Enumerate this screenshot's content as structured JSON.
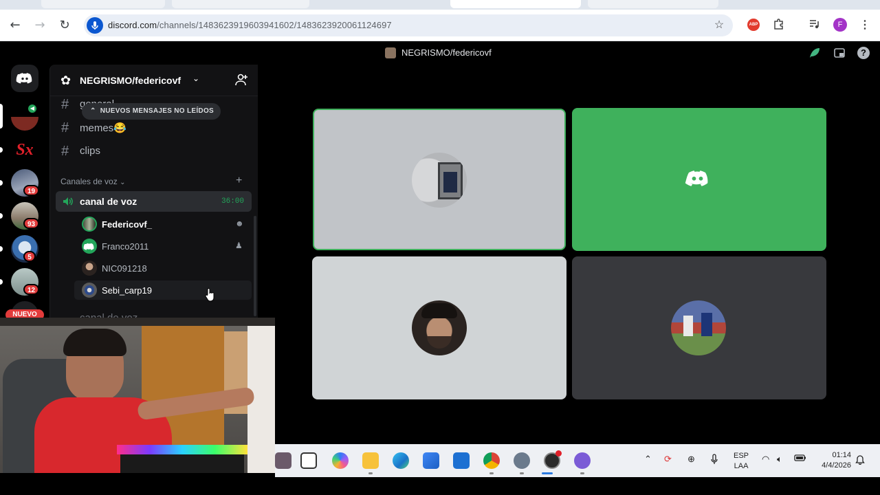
{
  "browser": {
    "url_host": "discord.com",
    "url_path": "/channels/1483623919603941602/1483623920061124697",
    "profile_initial": "F",
    "abp_label": "ABP"
  },
  "window_title": "NEGRISMO/federicovf",
  "server": {
    "name": "NEGRISMO/federicovf",
    "unread_toast": "NUEVOS MENSAJES NO LEÍDOS",
    "text_channels": [
      {
        "label": "general"
      },
      {
        "label": "memes😂"
      },
      {
        "label": "clips"
      }
    ],
    "voice_category": "Canales de voz",
    "voice_channel": {
      "label": "canal de voz",
      "timer": "36:00"
    },
    "voice_users": [
      {
        "name": "Federicovf_",
        "highlight": true
      },
      {
        "name": "Franco2011",
        "highlight": false
      },
      {
        "name": "NIC091218",
        "highlight": false
      },
      {
        "name": "Sebi_carp19",
        "highlight": true
      }
    ],
    "next_channel_partial": "canal de voz"
  },
  "rail": {
    "badges": [
      "19",
      "93",
      "5",
      "12"
    ],
    "new_label": "NUEVO"
  },
  "taskbar": {
    "lang_top": "ESP",
    "lang_bottom": "LAA",
    "time": "01:14",
    "date": "4/4/2026"
  },
  "colors": {
    "discord_green": "#23a55a",
    "tile_green": "#3fb15c",
    "badge_red": "#e23b3b"
  }
}
